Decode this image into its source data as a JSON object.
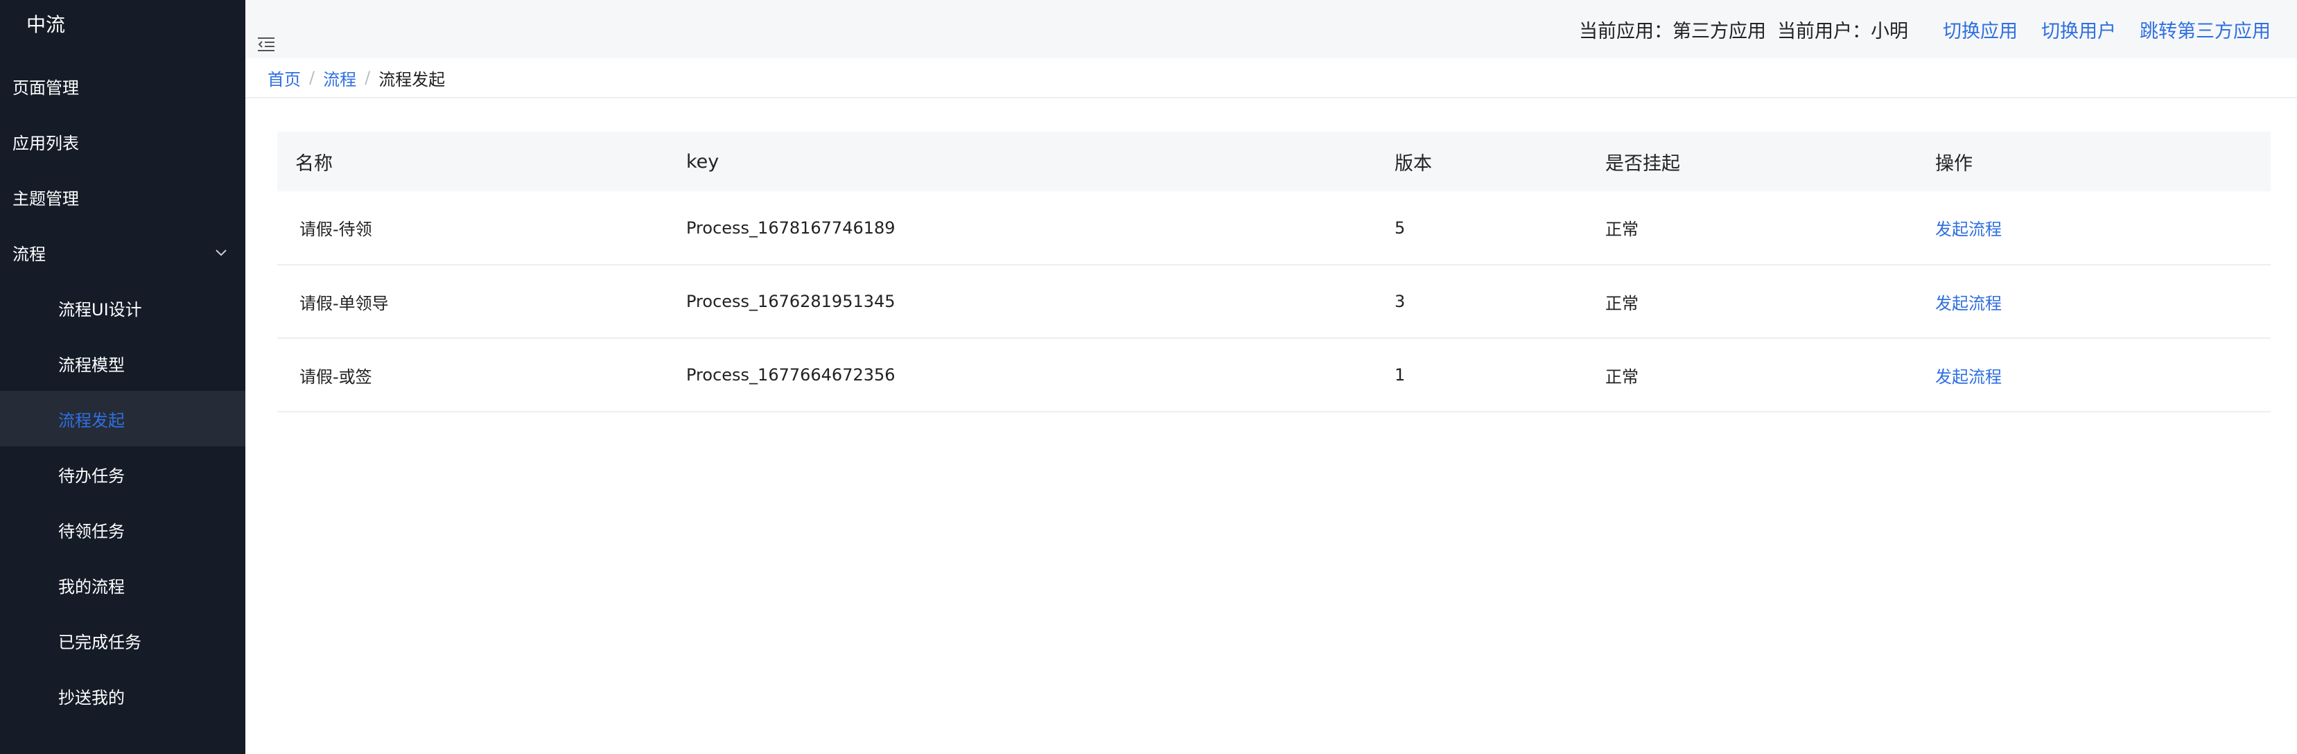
{
  "sidebar": {
    "logo": "中流",
    "items": [
      {
        "label": "页面管理"
      },
      {
        "label": "应用列表"
      },
      {
        "label": "主题管理"
      },
      {
        "label": "流程"
      }
    ],
    "sub_items": [
      {
        "label": "流程UI设计"
      },
      {
        "label": "流程模型"
      },
      {
        "label": "流程发起"
      },
      {
        "label": "待办任务"
      },
      {
        "label": "待领任务"
      },
      {
        "label": "我的流程"
      },
      {
        "label": "已完成任务"
      },
      {
        "label": "抄送我的"
      }
    ],
    "active_item": "流程发起",
    "accent_color": "#2f6fe0",
    "background": "#151c28"
  },
  "header": {
    "current_app_label": "当前应用：第三方应用",
    "current_user_label": "当前用户：小明",
    "switch_app": "切换应用",
    "switch_user": "切换用户",
    "jump_third_party": "跳转第三方应用"
  },
  "breadcrumb": {
    "home": "首页",
    "section": "流程",
    "current": "流程发起",
    "separator": "/"
  },
  "table": {
    "columns": [
      "名称",
      "key",
      "版本",
      "是否挂起",
      "操作"
    ],
    "rows": [
      {
        "name": "请假-待领",
        "key": "Process_1678167746189",
        "version": "5",
        "state": "正常",
        "action": "发起流程"
      },
      {
        "name": "请假-单领导",
        "key": "Process_1676281951345",
        "version": "3",
        "state": "正常",
        "action": "发起流程"
      },
      {
        "name": "请假-或签",
        "key": "Process_1677664672356",
        "version": "1",
        "state": "正常",
        "action": "发起流程"
      }
    ]
  },
  "icons": {
    "collapse": "menu-fold-icon",
    "expand": "chevron-down-icon"
  }
}
